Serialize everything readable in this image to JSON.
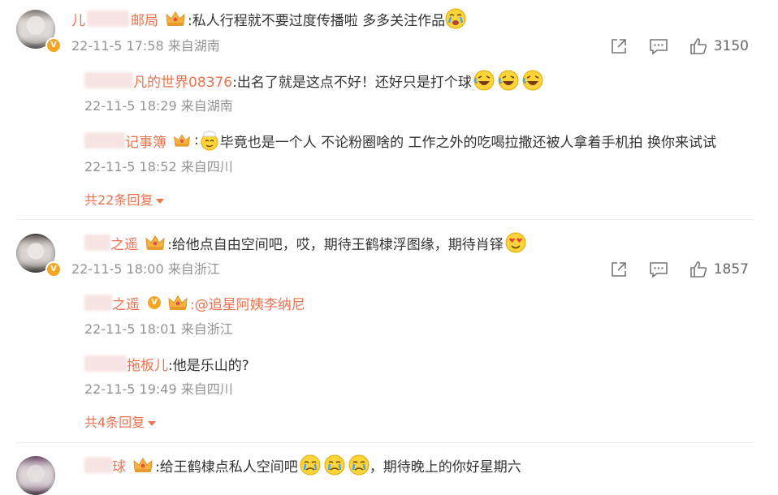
{
  "comments": [
    {
      "name": "儿",
      "name_tail": "邮局",
      "text": ":私人行程就不要过度传播啦 多多关注作品",
      "meta": "22-11-5 17:58 来自湖南",
      "likes": "3150",
      "replies": [
        {
          "name_tail": "凡的世界08376",
          "text": ":出名了就是这点不好！还好只是打个球",
          "meta": "22-11-5 18:29 来自湖南"
        },
        {
          "name_tail": "记事簿",
          "text": "毕竟也是一个人 不论粉圈啥的 工作之外的吃喝拉撒还被人拿着手机拍 换你来试试",
          "meta": "22-11-5 18:52 来自四川"
        }
      ],
      "more": "共22条回复"
    },
    {
      "name_tail": "之遥",
      "text": ":给他点自由空间吧，哎，期待王鹤棣浮图缘，期待肖铎",
      "meta": "22-11-5 18:00 来自浙江",
      "likes": "1857",
      "replies": [
        {
          "name_tail": "之遥",
          "text": ":@追星阿姨李纳尼",
          "meta": "22-11-5 18:01 来自浙江"
        },
        {
          "name_tail": "拖板儿",
          "text": ":他是乐山的?",
          "meta": "22-11-5 19:49 来自四川"
        }
      ],
      "more": "共4条回复"
    },
    {
      "name_tail": "球",
      "text": ":给王鹤棣点私人空间吧",
      "text2": "，期待晚上的你好星期六"
    }
  ],
  "icons": [
    "share-icon",
    "comment-icon",
    "like-icon",
    "crown-badge-icon",
    "verified-badge-icon"
  ],
  "colors": {
    "accent": "#eb7350",
    "meta": "#939393",
    "badge": "#f5a623"
  }
}
